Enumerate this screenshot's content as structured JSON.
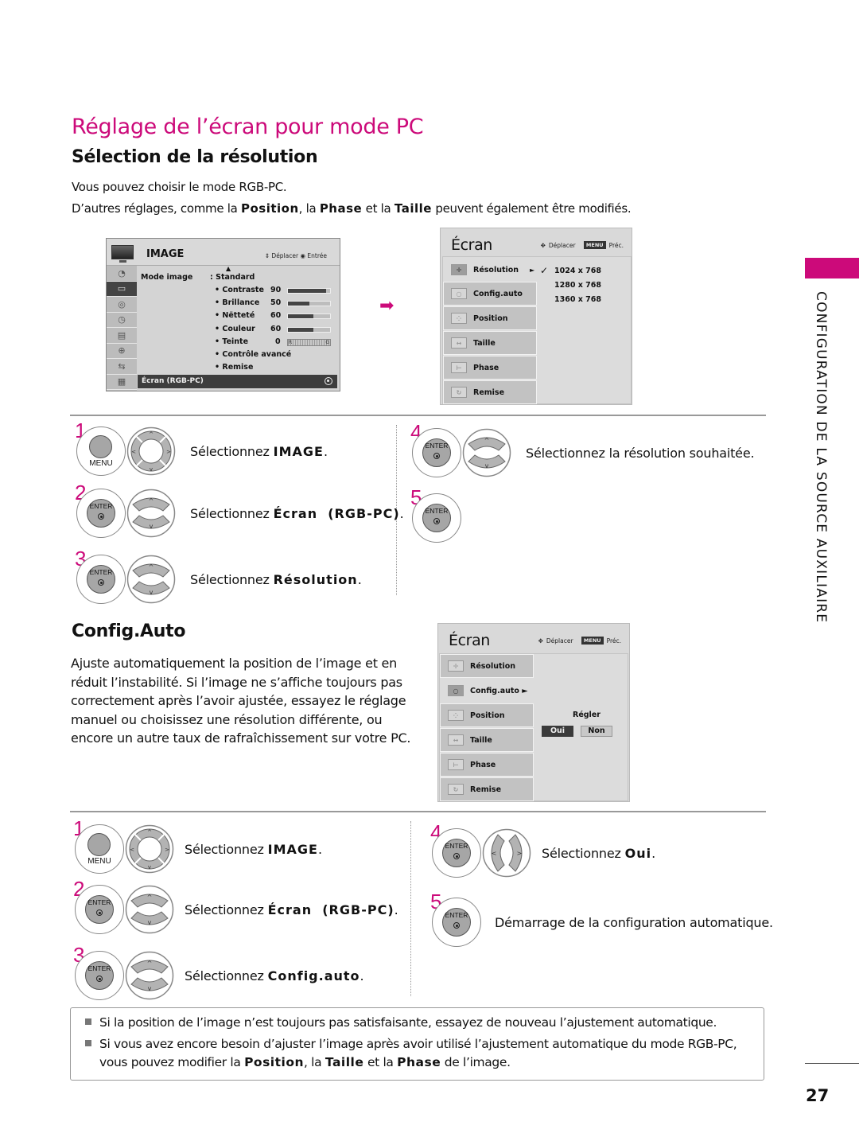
{
  "page": {
    "title": "Réglage de l’écran pour mode PC",
    "side_tab_label": "CONFIGURATION DE LA SOURCE AUXILIAIRE",
    "side_tab_color": "#cc0a7a",
    "accent_color": "#cc0a7a",
    "page_number": "27"
  },
  "resolution_section": {
    "title": "Sélection de la résolution",
    "intro_line1": "Vous pouvez choisir le mode RGB-PC.",
    "intro_line2_parts": {
      "a": "D’autres réglages, comme la ",
      "b": "Position",
      "c": ", la ",
      "d": "Phase",
      "e": " et la ",
      "f": "Taille",
      "g": " peuvent également être modifiés."
    },
    "image_osd": {
      "title": "IMAGE",
      "hint_move_icon": "move-arrows-icon",
      "hint_move": "Déplacer",
      "hint_enter": "Entrée",
      "side_icons": [
        "tv-icon",
        "satellite-icon",
        "picture-icon",
        "audio-icon",
        "clock-icon",
        "option-icon",
        "lock-icon",
        "input-icon",
        "usb-icon"
      ],
      "mode_label": "Mode image",
      "mode_value": ": Standard",
      "settings": [
        {
          "label": "• Contraste",
          "value": "90",
          "level": 0.9
        },
        {
          "label": "• Brillance",
          "value": "50",
          "level": 0.5
        },
        {
          "label": "• Nëtteté",
          "value": "60",
          "level": 0.6
        },
        {
          "label": "• Couleur",
          "value": "60",
          "level": 0.6
        },
        {
          "label": "• Teinte",
          "value": "0",
          "tint_left": "R",
          "tint_right": "G"
        }
      ],
      "extra_items": [
        "• Contrôle avancé",
        "• Remise"
      ],
      "footer_item": "Écran (RGB-PC)"
    },
    "ecran_osd": {
      "title": "Écran",
      "hint_move": "Déplacer",
      "hint_menu_key": "MENU",
      "hint_prev": "Préc.",
      "items": [
        {
          "label": "Résolution",
          "icon": "resolution-icon",
          "selected": true,
          "arrow": "►"
        },
        {
          "label": "Config.auto",
          "icon": "autoconfig-icon"
        },
        {
          "label": "Position",
          "icon": "position-icon"
        },
        {
          "label": "Taille",
          "icon": "size-icon"
        },
        {
          "label": "Phase",
          "icon": "phase-icon"
        },
        {
          "label": "Remise",
          "icon": "reset-icon"
        }
      ],
      "resolutions": [
        {
          "label": "1024 x 768",
          "checked": true
        },
        {
          "label": "1280 x 768",
          "checked": false
        },
        {
          "label": "1360 x 768",
          "checked": false
        }
      ],
      "check_mark": "✓"
    },
    "steps": [
      {
        "num": "1",
        "button": "MENU",
        "pad": "4-way",
        "text": "Sélectionnez ",
        "bold": "IMAGE",
        "end": "."
      },
      {
        "num": "2",
        "button": "ENTER",
        "pad": "up-down",
        "text": "Sélectionnez ",
        "bold": "Écran  (RGB-PC)",
        "end": "."
      },
      {
        "num": "3",
        "button": "ENTER",
        "pad": "up-down",
        "text": "Sélectionnez ",
        "bold": "Résolution",
        "end": "."
      },
      {
        "num": "4",
        "button": "ENTER",
        "pad": "up-down",
        "text": "Sélectionnez la résolution souhaitée.",
        "bold": "",
        "end": ""
      },
      {
        "num": "5",
        "button": "ENTER",
        "pad": "",
        "text": "",
        "bold": "",
        "end": ""
      }
    ]
  },
  "config_section": {
    "title": "Config.Auto",
    "description": "Ajuste automatiquement la position de l’image et en réduit l’instabilité. Si l’image ne s’affiche toujours pas correctement après l’avoir ajustée, essayez le réglage manuel ou choisissez une résolution différente, ou encore un autre taux de rafraîchissement sur votre PC.",
    "ecran_osd": {
      "title": "Écran",
      "hint_move": "Déplacer",
      "hint_menu_key": "MENU",
      "hint_prev": "Préc.",
      "items": [
        {
          "label": "Résolution",
          "icon": "resolution-icon"
        },
        {
          "label": "Config.auto ►",
          "icon": "autoconfig-icon",
          "selected": true
        },
        {
          "label": "Position",
          "icon": "position-icon"
        },
        {
          "label": "Taille",
          "icon": "size-icon"
        },
        {
          "label": "Phase",
          "icon": "phase-icon"
        },
        {
          "label": "Remise",
          "icon": "reset-icon"
        }
      ],
      "adjust_label": "Régler",
      "yes_label": "Oui",
      "no_label": "Non",
      "selected_option": "Oui"
    },
    "steps": [
      {
        "num": "1",
        "button": "MENU",
        "pad": "4-way",
        "text": "Sélectionnez ",
        "bold": "IMAGE",
        "end": "."
      },
      {
        "num": "2",
        "button": "ENTER",
        "pad": "up-down",
        "text": "Sélectionnez ",
        "bold": "Écran  (RGB-PC)",
        "end": "."
      },
      {
        "num": "3",
        "button": "ENTER",
        "pad": "up-down",
        "text": "Sélectionnez ",
        "bold": "Config.auto",
        "end": "."
      },
      {
        "num": "4",
        "button": "ENTER",
        "pad": "left-right",
        "text": "Sélectionnez ",
        "bold": "Oui",
        "end": "."
      },
      {
        "num": "5",
        "button": "ENTER",
        "pad": "",
        "text": "Démarrage de la configuration automatique.",
        "bold": "",
        "end": ""
      }
    ]
  },
  "notes": {
    "note1": "Si la position de l’image n’est toujours pas satisfaisante, essayez de nouveau l’ajustement automatique.",
    "note2_line1": "Si vous avez encore besoin d’ajuster l’image après avoir utilisé l’ajustement automatique du mode RGB-PC,",
    "note2_line2_parts": {
      "a": "vous pouvez modifier la ",
      "b": "Position",
      "c": ", la ",
      "d": "Taille",
      "e": " et la ",
      "f": "Phase",
      "g": " de l’image."
    }
  },
  "buttons": {
    "menu_caption": "MENU",
    "enter_caption": "ENTER"
  }
}
